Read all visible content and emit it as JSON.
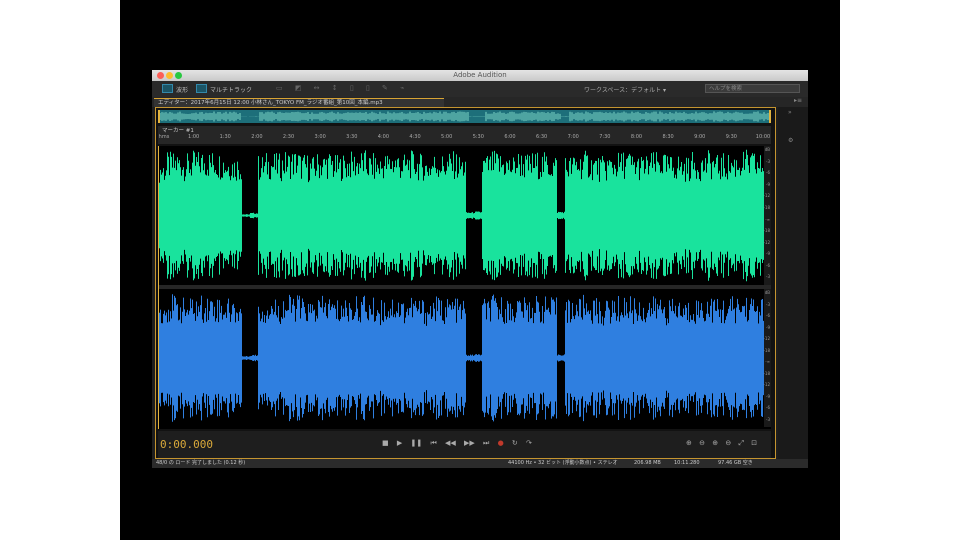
{
  "window": {
    "title": "Adobe Audition"
  },
  "toolbar": {
    "waveform_label": "波形",
    "multitrack_label": "マルチトラック",
    "workspace_label": "ワークスペース：",
    "workspace_value": "デフォルト",
    "search_placeholder": "ヘルプを検索"
  },
  "tab": {
    "label": "エディター：2017年6月15日 12:00 小林さん_TOKYO FM_ラジオ番組_第10回_本編.mp3"
  },
  "ruler": {
    "label": "マーカー #1",
    "ticks": [
      "hms",
      "1:00",
      "1:30",
      "2:00",
      "2:30",
      "3:00",
      "3:30",
      "4:00",
      "4:30",
      "5:00",
      "5:30",
      "6:00",
      "6:30",
      "7:00",
      "7:30",
      "8:00",
      "8:30",
      "9:00",
      "9:30",
      "10:00"
    ]
  },
  "db_scale": {
    "ch1": [
      "dB",
      "-3",
      "-6",
      "-9",
      "-12",
      "-18",
      "-∞",
      "-18",
      "-12",
      "-9",
      "-6",
      "-3"
    ],
    "ch2": [
      "dB",
      "-3",
      "-6",
      "-9",
      "-12",
      "-18",
      "-∞",
      "-18",
      "-12",
      "-9",
      "-6",
      "-3"
    ]
  },
  "transport": {
    "timecode": "0:00.000"
  },
  "status": {
    "left": "48/0 の ロード 完了しました (0.12 秒)",
    "format": "44100 Hz • 32 ビット (浮動小数点) • ステレオ",
    "size": "206.98 MB",
    "duration": "10:11.280",
    "free": "97.46 GB 空き"
  },
  "colors": {
    "channel1": "#19e39d",
    "channel2": "#2f7fe0",
    "accent": "#e2b440"
  },
  "waveform": {
    "ch1_envelope": [
      0.82,
      0.92,
      0.94,
      0.9,
      0.94,
      0.96,
      0.95,
      0.93,
      0.9,
      0.88,
      0.02,
      0.04,
      0.88,
      0.92,
      0.9,
      0.94,
      0.96,
      0.9,
      0.86,
      0.92,
      0.94,
      0.88,
      0.9,
      0.93,
      0.95,
      0.9,
      0.88,
      0.92,
      0.95,
      0.9,
      0.94,
      0.9,
      0.86,
      0.92,
      0.9,
      0.93,
      0.88,
      0.05,
      0.06,
      0.9,
      0.94,
      0.92,
      0.88,
      0.95,
      0.9,
      0.93,
      0.92,
      0.9,
      0.06,
      0.88,
      0.92,
      0.94,
      0.9,
      0.86,
      0.9,
      0.92,
      0.95,
      0.9,
      0.88,
      0.92,
      0.94,
      0.88,
      0.9,
      0.86,
      0.92,
      0.9,
      0.94,
      0.88,
      0.9,
      0.92,
      0.95,
      0.93,
      0.9
    ],
    "ch2_envelope": [
      0.85,
      0.93,
      0.9,
      0.88,
      0.9,
      0.92,
      0.94,
      0.9,
      0.88,
      0.86,
      0.03,
      0.05,
      0.86,
      0.9,
      0.88,
      0.92,
      0.94,
      0.88,
      0.84,
      0.9,
      0.92,
      0.86,
      0.88,
      0.9,
      0.93,
      0.88,
      0.86,
      0.9,
      0.93,
      0.88,
      0.92,
      0.88,
      0.84,
      0.9,
      0.88,
      0.91,
      0.86,
      0.05,
      0.06,
      0.88,
      0.92,
      0.9,
      0.86,
      0.93,
      0.88,
      0.91,
      0.9,
      0.88,
      0.06,
      0.86,
      0.9,
      0.92,
      0.88,
      0.84,
      0.88,
      0.9,
      0.93,
      0.88,
      0.86,
      0.9,
      0.92,
      0.86,
      0.88,
      0.84,
      0.9,
      0.88,
      0.92,
      0.86,
      0.88,
      0.9,
      0.93,
      0.91,
      0.88
    ]
  }
}
